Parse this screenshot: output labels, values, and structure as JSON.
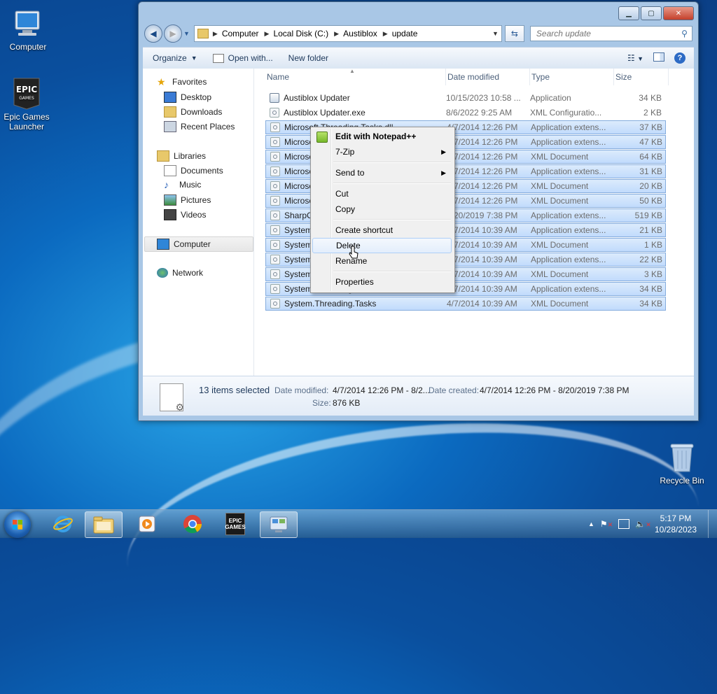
{
  "desktop": {
    "icons": [
      {
        "label": "Computer"
      },
      {
        "label": "Epic Games Launcher"
      },
      {
        "label": "Recycle Bin"
      }
    ]
  },
  "window": {
    "address": {
      "crumbs": [
        "Computer",
        "Local Disk (C:)",
        "Austiblox",
        "update"
      ]
    },
    "search": {
      "placeholder": "Search update"
    },
    "toolbar": {
      "organize": "Organize",
      "open_with": "Open with...",
      "new_folder": "New folder"
    },
    "navpane": {
      "favorites": "Favorites",
      "favorites_items": [
        "Desktop",
        "Downloads",
        "Recent Places"
      ],
      "libraries": "Libraries",
      "libraries_items": [
        "Documents",
        "Music",
        "Pictures",
        "Videos"
      ],
      "computer": "Computer",
      "network": "Network"
    },
    "columns": {
      "name": "Name",
      "date": "Date modified",
      "type": "Type",
      "size": "Size"
    },
    "files": [
      {
        "name": "Austiblox Updater",
        "date": "10/15/2023 10:58 ...",
        "type": "Application",
        "size": "34 KB"
      },
      {
        "name": "Austiblox Updater.exe",
        "date": "8/6/2022 9:25 AM",
        "type": "XML Configuratio...",
        "size": "2 KB"
      },
      {
        "name": "Microsoft.Threading.Tasks.dll",
        "date": "4/7/2014 12:26 PM",
        "type": "Application extens...",
        "size": "37 KB"
      },
      {
        "name": "Microsoft.Threading.Tasks.Extensions.Desktop.dll",
        "date": "4/7/2014 12:26 PM",
        "type": "Application extens...",
        "size": "47 KB"
      },
      {
        "name": "Microsoft.Threading.Tasks.Extensions.Desktop",
        "date": "4/7/2014 12:26 PM",
        "type": "XML Document",
        "size": "64 KB"
      },
      {
        "name": "Microsoft.Threading.Tasks.Extensions.dll",
        "date": "4/7/2014 12:26 PM",
        "type": "Application extens...",
        "size": "31 KB"
      },
      {
        "name": "Microsoft.Threading.Tasks.Extensions",
        "date": "4/7/2014 12:26 PM",
        "type": "XML Document",
        "size": "20 KB"
      },
      {
        "name": "Microsoft.Threading.Tasks",
        "date": "4/7/2014 12:26 PM",
        "type": "XML Document",
        "size": "50 KB"
      },
      {
        "name": "SharpCompress.dll",
        "date": "8/20/2019 7:38 PM",
        "type": "Application extens...",
        "size": "519 KB"
      },
      {
        "name": "System.IO.dll",
        "date": "4/7/2014 10:39 AM",
        "type": "Application extens...",
        "size": "21 KB"
      },
      {
        "name": "System.IO",
        "date": "4/7/2014 10:39 AM",
        "type": "XML Document",
        "size": "1 KB"
      },
      {
        "name": "System.Runtime.dll",
        "date": "4/7/2014 10:39 AM",
        "type": "Application extens...",
        "size": "22 KB"
      },
      {
        "name": "System.Runtime",
        "date": "4/7/2014 10:39 AM",
        "type": "XML Document",
        "size": "3 KB"
      },
      {
        "name": "System.Threading.Tasks.dll",
        "date": "4/7/2014 10:39 AM",
        "type": "Application extens...",
        "size": "34 KB"
      },
      {
        "name": "System.Threading.Tasks",
        "date": "4/7/2014 10:39 AM",
        "type": "XML Document",
        "size": "34 KB"
      }
    ],
    "details": {
      "count": "13 items selected",
      "modified_label": "Date modified:",
      "modified_value": "4/7/2014 12:26 PM - 8/2...",
      "created_label": "Date created:",
      "created_value": "4/7/2014 12:26 PM - 8/20/2019 7:38 PM",
      "size_label": "Size:",
      "size_value": "876 KB"
    }
  },
  "context_menu": {
    "items": [
      "Edit with Notepad++",
      "7-Zip",
      "Send to",
      "Cut",
      "Copy",
      "Create shortcut",
      "Delete",
      "Rename",
      "Properties"
    ]
  },
  "taskbar": {
    "time": "5:17 PM",
    "date": "10/28/2023",
    "epic_label": "EPIC\nGAMES"
  }
}
